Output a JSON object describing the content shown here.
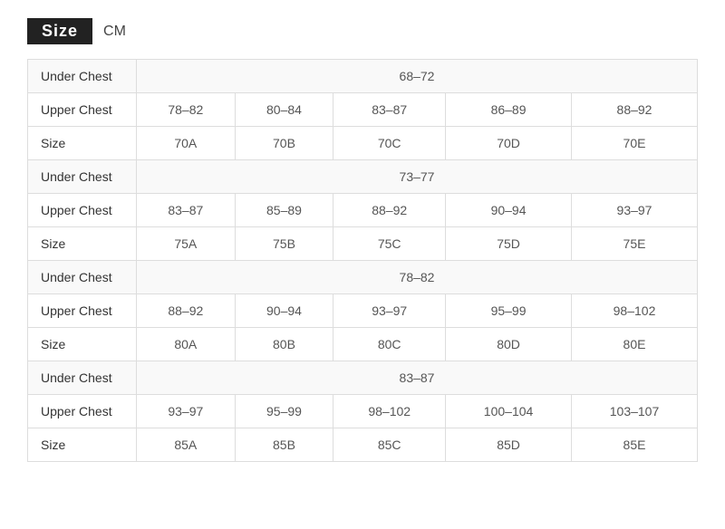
{
  "header": {
    "size_label": "Size",
    "unit": "CM"
  },
  "groups": [
    {
      "under_chest": {
        "label": "Under Chest",
        "value": "68–72"
      },
      "upper_chest": {
        "label": "Upper Chest",
        "values": [
          "78–82",
          "80–84",
          "83–87",
          "86–89",
          "88–92"
        ]
      },
      "size": {
        "label": "Size",
        "values": [
          "70A",
          "70B",
          "70C",
          "70D",
          "70E"
        ]
      }
    },
    {
      "under_chest": {
        "label": "Under Chest",
        "value": "73–77"
      },
      "upper_chest": {
        "label": "Upper Chest",
        "values": [
          "83–87",
          "85–89",
          "88–92",
          "90–94",
          "93–97"
        ]
      },
      "size": {
        "label": "Size",
        "values": [
          "75A",
          "75B",
          "75C",
          "75D",
          "75E"
        ]
      }
    },
    {
      "under_chest": {
        "label": "Under Chest",
        "value": "78–82"
      },
      "upper_chest": {
        "label": "Upper Chest",
        "values": [
          "88–92",
          "90–94",
          "93–97",
          "95–99",
          "98–102"
        ]
      },
      "size": {
        "label": "Size",
        "values": [
          "80A",
          "80B",
          "80C",
          "80D",
          "80E"
        ]
      }
    },
    {
      "under_chest": {
        "label": "Under Chest",
        "value": "83–87"
      },
      "upper_chest": {
        "label": "Upper Chest",
        "values": [
          "93–97",
          "95–99",
          "98–102",
          "100–104",
          "103–107"
        ]
      },
      "size": {
        "label": "Size",
        "values": [
          "85A",
          "85B",
          "85C",
          "85D",
          "85E"
        ]
      }
    }
  ]
}
